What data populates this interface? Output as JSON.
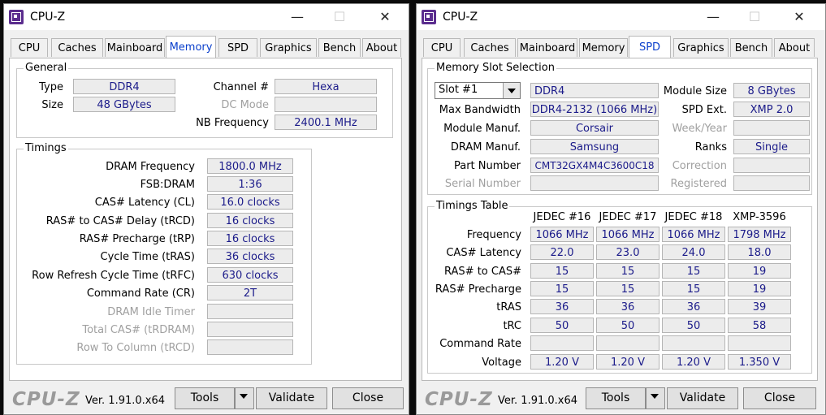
{
  "left": {
    "title": "CPU-Z",
    "tabs": [
      "CPU",
      "Caches",
      "Mainboard",
      "Memory",
      "SPD",
      "Graphics",
      "Bench",
      "About"
    ],
    "general": {
      "legend": "General",
      "type_label": "Type",
      "type_value": "DDR4",
      "size_label": "Size",
      "size_value": "48 GBytes",
      "channel_label": "Channel #",
      "channel_value": "Hexa",
      "dcmode_label": "DC Mode",
      "dcmode_value": "",
      "nbfreq_label": "NB Frequency",
      "nbfreq_value": "2400.1 MHz"
    },
    "timings": {
      "legend": "Timings",
      "rows": [
        {
          "label": "DRAM Frequency",
          "value": "1800.0 MHz"
        },
        {
          "label": "FSB:DRAM",
          "value": "1:36"
        },
        {
          "label": "CAS# Latency (CL)",
          "value": "16.0 clocks"
        },
        {
          "label": "RAS# to CAS# Delay (tRCD)",
          "value": "16 clocks"
        },
        {
          "label": "RAS# Precharge (tRP)",
          "value": "16 clocks"
        },
        {
          "label": "Cycle Time (tRAS)",
          "value": "36 clocks"
        },
        {
          "label": "Row Refresh Cycle Time (tRFC)",
          "value": "630 clocks"
        },
        {
          "label": "Command Rate (CR)",
          "value": "2T"
        },
        {
          "label": "DRAM Idle Timer",
          "value": ""
        },
        {
          "label": "Total CAS# (tRDRAM)",
          "value": ""
        },
        {
          "label": "Row To Column (tRCD)",
          "value": ""
        }
      ]
    },
    "footer": {
      "brand": "CPU-Z",
      "version": "Ver. 1.91.0.x64",
      "tools": "Tools",
      "validate": "Validate",
      "close": "Close"
    }
  },
  "right": {
    "title": "CPU-Z",
    "tabs": [
      "CPU",
      "Caches",
      "Mainboard",
      "Memory",
      "SPD",
      "Graphics",
      "Bench",
      "About"
    ],
    "slot": {
      "legend": "Memory Slot Selection",
      "selected": "Slot #1",
      "type_value": "DDR4",
      "module_size_label": "Module Size",
      "module_size_value": "8 GBytes",
      "max_bw_label": "Max Bandwidth",
      "max_bw_value": "DDR4-2132 (1066 MHz)",
      "spd_ext_label": "SPD Ext.",
      "spd_ext_value": "XMP 2.0",
      "manuf_label": "Module Manuf.",
      "manuf_value": "Corsair",
      "weekyear_label": "Week/Year",
      "weekyear_value": "",
      "dram_manuf_label": "DRAM Manuf.",
      "dram_manuf_value": "Samsung",
      "ranks_label": "Ranks",
      "ranks_value": "Single",
      "part_label": "Part Number",
      "part_value": "CMT32GX4M4C3600C18",
      "correction_label": "Correction",
      "correction_value": "",
      "serial_label": "Serial Number",
      "serial_value": "",
      "registered_label": "Registered",
      "registered_value": ""
    },
    "timings_table": {
      "legend": "Timings Table",
      "headers": [
        "JEDEC #16",
        "JEDEC #17",
        "JEDEC #18",
        "XMP-3596"
      ],
      "rows": [
        {
          "label": "Frequency",
          "values": [
            "1066 MHz",
            "1066 MHz",
            "1066 MHz",
            "1798 MHz"
          ]
        },
        {
          "label": "CAS# Latency",
          "values": [
            "22.0",
            "23.0",
            "24.0",
            "18.0"
          ]
        },
        {
          "label": "RAS# to CAS#",
          "values": [
            "15",
            "15",
            "15",
            "19"
          ]
        },
        {
          "label": "RAS# Precharge",
          "values": [
            "15",
            "15",
            "15",
            "19"
          ]
        },
        {
          "label": "tRAS",
          "values": [
            "36",
            "36",
            "36",
            "39"
          ]
        },
        {
          "label": "tRC",
          "values": [
            "50",
            "50",
            "50",
            "58"
          ]
        },
        {
          "label": "Command Rate",
          "values": [
            "",
            "",
            "",
            ""
          ]
        },
        {
          "label": "Voltage",
          "values": [
            "1.20 V",
            "1.20 V",
            "1.20 V",
            "1.350 V"
          ]
        }
      ]
    },
    "footer": {
      "brand": "CPU-Z",
      "version": "Ver. 1.91.0.x64",
      "tools": "Tools",
      "validate": "Validate",
      "close": "Close"
    }
  }
}
